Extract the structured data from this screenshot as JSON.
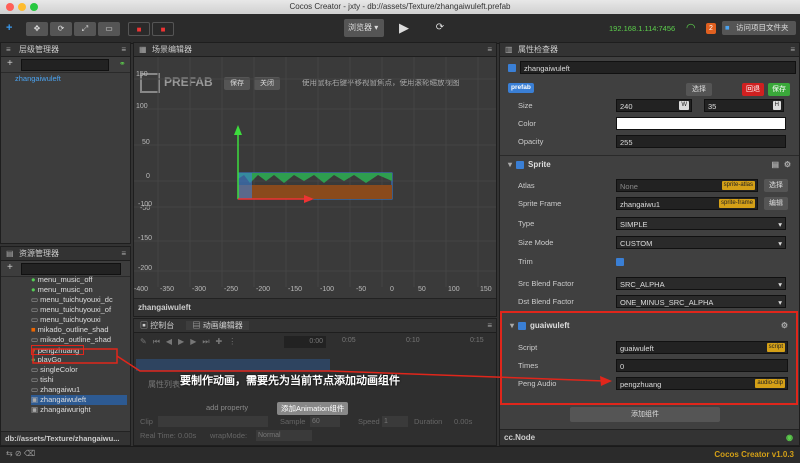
{
  "window": {
    "title": "Cocos Creator - jxty - db://assets/Texture/zhangaiwuleft.prefab"
  },
  "toolbar": {
    "preview_select": "浏览器",
    "play_icon": "play-icon",
    "ip": "192.168.1.114:7456",
    "badge": "2",
    "open_project": "访问项目文件夹"
  },
  "hierarchy": {
    "title": "层级管理器",
    "items": [
      "zhangaiwuleft"
    ]
  },
  "scene": {
    "title": "场景编辑器",
    "prefab_label": "PREFAB",
    "save": "保存",
    "close": "关闭",
    "hint": "使用鼠标右键平移视窗焦点，使用滚轮缩放视图",
    "y_ticks": [
      "150",
      "100",
      "50",
      "0",
      "-50",
      "-100",
      "-150",
      "-200"
    ],
    "x_ticks": [
      "-400",
      "-350",
      "-300",
      "-250",
      "-200",
      "-150",
      "-100",
      "-50",
      "0",
      "50",
      "100",
      "150"
    ],
    "node_name": "zhangaiwuleft"
  },
  "assets": {
    "title": "资源管理器",
    "items": [
      "menu_music_off",
      "menu_music_on",
      "menu_tuichuyouxi_dc",
      "menu_tuichuyouxi_of",
      "menu_tuichuyouxi",
      "mikado_outline_shad",
      "mikado_outline_shad",
      "pengzhuang",
      "playGo",
      "singleColor",
      "tishi",
      "zhangaiwu1",
      "zhangaiwuleft",
      "zhangaiwuright"
    ],
    "path": "db://assets/Texture/zhangaiwu..."
  },
  "bottom": {
    "tab_console": "控制台",
    "tab_anim": "动画编辑器",
    "time": "0:00",
    "timeline": [
      "0:05",
      "0:10",
      "0:15"
    ],
    "props_label": "属性列表",
    "add_property": "add property",
    "add_anim_btn": "添加Animation组件",
    "clip_label": "Clip",
    "sample_label": "Sample",
    "sample_val": "60",
    "speed_label": "Speed",
    "speed_val": "1",
    "duration_label": "Duration",
    "duration_val": "0.00s",
    "realtime": "Real Time: 0.00s",
    "wrapmode_label": "wrapMode:",
    "wrapmode_val": "Normal"
  },
  "annotation": "要制作动画，需要先为当前节点添加动画组件",
  "inspector": {
    "title": "属性检查器",
    "node_name": "zhangaiwuleft",
    "prefab_badge": "prefab",
    "btn_select": "选择",
    "btn_revert": "回退",
    "btn_save": "保存",
    "size_label": "Size",
    "size_w": "240",
    "size_w_tag": "W",
    "size_h": "35",
    "size_h_tag": "H",
    "color_label": "Color",
    "opacity_label": "Opacity",
    "opacity_val": "255",
    "sprite_title": "Sprite",
    "atlas_label": "Atlas",
    "atlas_val": "None",
    "atlas_tag": "sprite-atlas",
    "atlas_btn": "选择",
    "frame_label": "Sprite Frame",
    "frame_val": "zhangaiwu1",
    "frame_tag": "sprite-frame",
    "frame_btn": "编辑",
    "type_label": "Type",
    "type_val": "SIMPLE",
    "sizemode_label": "Size Mode",
    "sizemode_val": "CUSTOM",
    "trim_label": "Trim",
    "src_label": "Src Blend Factor",
    "src_val": "SRC_ALPHA",
    "dst_label": "Dst Blend Factor",
    "dst_val": "ONE_MINUS_SRC_ALPHA",
    "comp_title": "guaiwuleft",
    "script_label": "Script",
    "script_val": "guaiwuleft",
    "script_tag": "script",
    "times_label": "Times",
    "times_val": "0",
    "audio_label": "Peng Audio",
    "audio_val": "pengzhuang",
    "audio_tag": "audio-clip",
    "add_component": "添加组件",
    "footer": "cc.Node"
  },
  "status": {
    "version": "Cocos Creator v1.0.3"
  },
  "colors": {
    "accent": "#3a7fd5",
    "annotation_red": "#e0261b",
    "grass": "#2e9e4f",
    "dirt": "#8a4a1c"
  }
}
